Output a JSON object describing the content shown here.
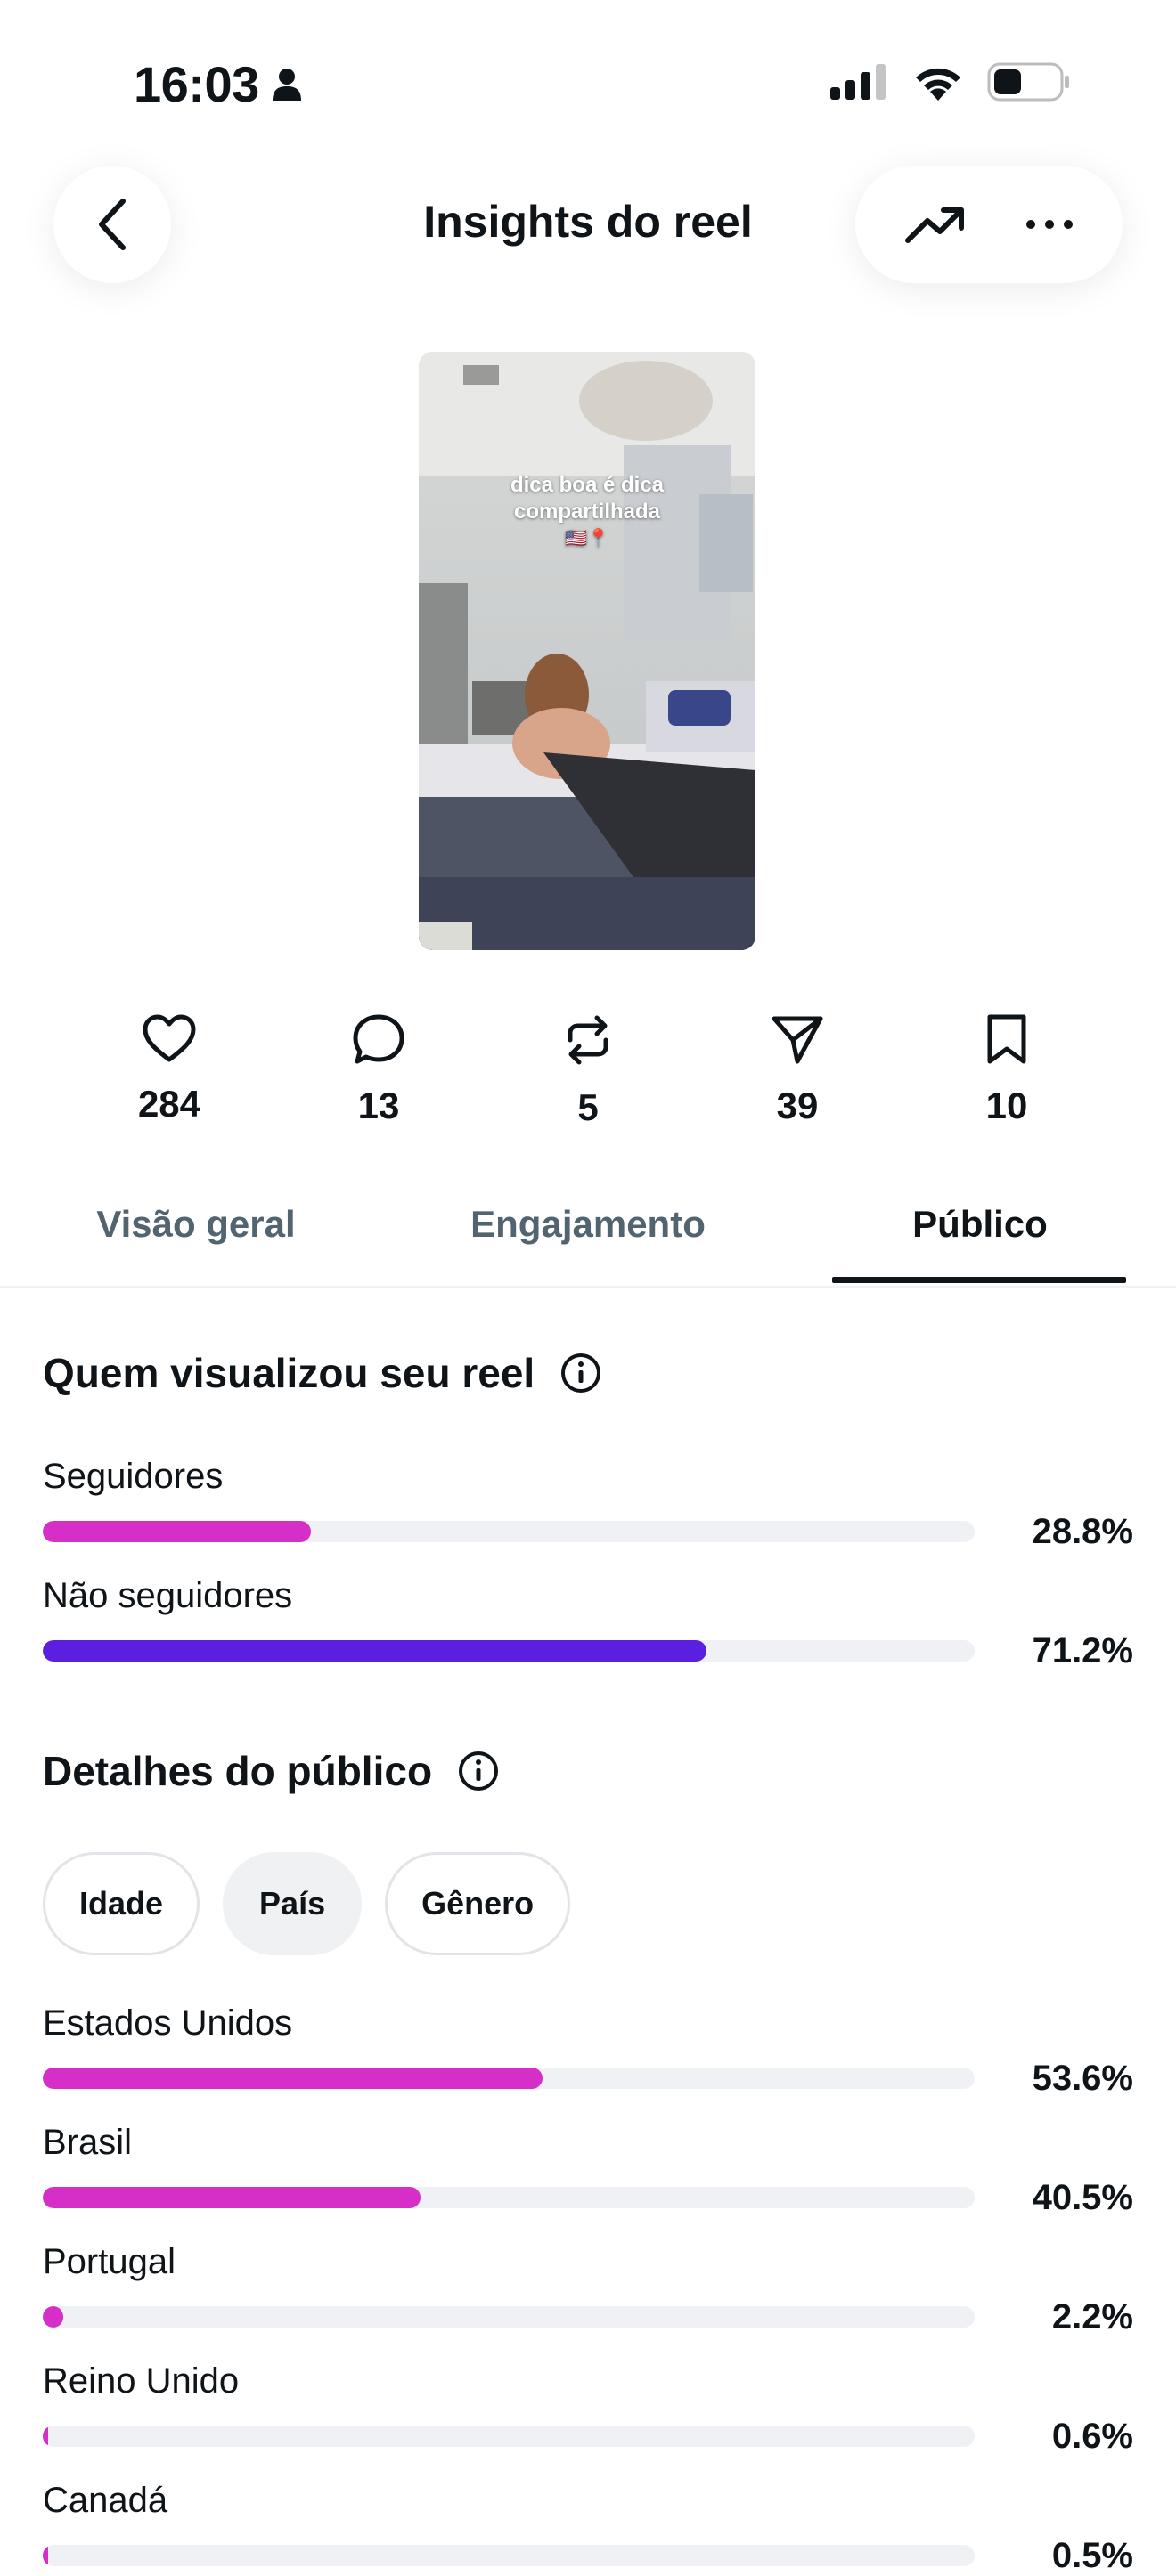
{
  "status_bar": {
    "time": "16:03"
  },
  "header": {
    "title": "Insights do reel"
  },
  "thumbnail": {
    "caption_line1": "dica boa é dica",
    "caption_line2": "compartilhada",
    "caption_emoji": "🇺🇸📍"
  },
  "stats": [
    {
      "icon": "heart-icon",
      "value": "284"
    },
    {
      "icon": "comment-icon",
      "value": "13"
    },
    {
      "icon": "repost-icon",
      "value": "5"
    },
    {
      "icon": "share-icon",
      "value": "39"
    },
    {
      "icon": "bookmark-icon",
      "value": "10"
    }
  ],
  "tabs": [
    {
      "label": "Visão geral"
    },
    {
      "label": "Engajamento"
    },
    {
      "label": "Público",
      "selected": true
    }
  ],
  "viewers": {
    "title": "Quem visualizou seu reel",
    "rows": [
      {
        "label": "Seguidores",
        "value": "28.8%",
        "fraction": 0.288,
        "color": "#d62fc8"
      },
      {
        "label": "Não seguidores",
        "value": "71.2%",
        "fraction": 0.712,
        "color": "#5b1fe0"
      }
    ]
  },
  "audience": {
    "title": "Detalhes do público",
    "chips": [
      {
        "label": "Idade"
      },
      {
        "label": "País",
        "selected": true
      },
      {
        "label": "Gênero"
      }
    ],
    "rows": [
      {
        "label": "Estados Unidos",
        "value": "53.6%",
        "fraction": 0.536,
        "color": "#d62fc8"
      },
      {
        "label": "Brasil",
        "value": "40.5%",
        "fraction": 0.405,
        "color": "#d62fc8"
      },
      {
        "label": "Portugal",
        "value": "2.2%",
        "fraction": 0.022,
        "color": "#d62fc8"
      },
      {
        "label": "Reino Unido",
        "value": "0.6%",
        "fraction": 0.006,
        "color": "#d62fc8"
      },
      {
        "label": "Canadá",
        "value": "0.5%",
        "fraction": 0.005,
        "color": "#d62fc8"
      }
    ]
  }
}
